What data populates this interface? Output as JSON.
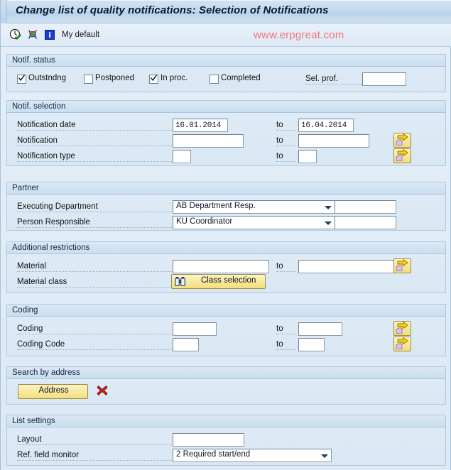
{
  "window": {
    "title": "Change list of quality notifications: Selection of Notifications"
  },
  "toolbar": {
    "icons": [
      {
        "name": "execute-clock-icon",
        "glyph": "clock-check"
      },
      {
        "name": "multiple-selection-icon",
        "glyph": "bars"
      },
      {
        "name": "info-icon",
        "glyph": "info"
      }
    ],
    "my_default_label": "My default",
    "watermark": "www.erpgreat.com"
  },
  "sections": {
    "notif_status": {
      "title": "Notif. status",
      "checkboxes": [
        {
          "label": "Outstndng",
          "checked": true
        },
        {
          "label": "Postponed",
          "checked": false
        },
        {
          "label": "In proc.",
          "checked": true
        },
        {
          "label": "Completed",
          "checked": false
        }
      ],
      "sel_prof_label": "Sel. prof.",
      "sel_prof_value": "",
      "sel_prof_placeholder": ""
    },
    "notif_selection": {
      "title": "Notif. selection",
      "to_label": "to",
      "rows": [
        {
          "label": "Notification date",
          "from_value": "16.01.2014",
          "to_value": "16.04.2014",
          "has_multi_select": false
        },
        {
          "label": "Notification",
          "from_value": "",
          "to_value": "",
          "has_multi_select": true
        },
        {
          "label": "Notification type",
          "from_value": "",
          "to_value": "",
          "has_multi_select": true
        }
      ]
    },
    "partner": {
      "title": "Partner",
      "rows": [
        {
          "label": "Executing Department",
          "selected": "AB Department Resp.",
          "side_value": ""
        },
        {
          "label": "Person Responsible",
          "selected": "KU Coordinator",
          "side_value": ""
        }
      ]
    },
    "additional_restrictions": {
      "title": "Additional restrictions",
      "to_label": "to",
      "material_label": "Material",
      "material_from": "",
      "material_to": "",
      "material_class_label": "Material class",
      "class_selection_button": "Class selection"
    },
    "coding": {
      "title": "Coding",
      "to_label": "to",
      "rows": [
        {
          "label": "Coding",
          "from_value": "",
          "to_value": ""
        },
        {
          "label": "Coding Code",
          "from_value": "",
          "to_value": ""
        }
      ]
    },
    "search_by_address": {
      "title": "Search by address",
      "address_button": "Address",
      "delete_icon_name": "delete-red-x-icon"
    },
    "list_settings": {
      "title": "List settings",
      "layout_label": "Layout",
      "layout_value": "",
      "ref_field_monitor_label": "Ref. field monitor",
      "ref_field_monitor_value": "2 Required start/end"
    }
  },
  "colors": {
    "accent_yellow": "#f4de7c",
    "watermark_red": "#f2717b",
    "group_border": "#b0c8dd",
    "background": "#dce9f5"
  }
}
